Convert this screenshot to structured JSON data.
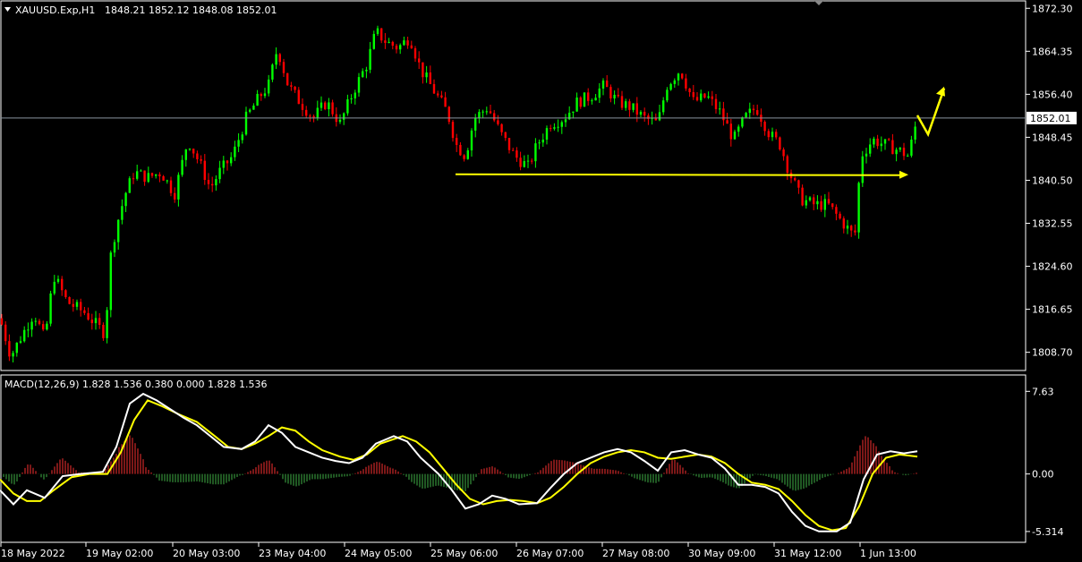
{
  "header": {
    "symbol": "XAUUSD.Exp,H1",
    "ohlc": "1848.21 1852.12 1848.08 1852.01",
    "macd_label": "MACD(12,26,9) 1.828 1.536 0.380 0.000 1.828 1.536"
  },
  "colors": {
    "background": "#000000",
    "frame": "#ffffff",
    "bull": "#00ff00",
    "bear": "#ff0000",
    "current_price_line": "#8a94a0",
    "annotation": "#ffff00",
    "macd_line": "#ffffff",
    "signal_line": "#ffff00",
    "histogram_positive": "#b22222",
    "histogram_negative": "#2e7d32"
  },
  "chart_data": [
    {
      "type": "candlestick",
      "name": "price",
      "ylim": [
        1805.5,
        1873.5
      ],
      "y_ticks": [
        "1872.30",
        "1864.35",
        "1856.40",
        "1848.45",
        "1840.50",
        "1832.55",
        "1824.60",
        "1816.65",
        "1808.70"
      ],
      "current_price": "1852.01",
      "x_labels": [
        "18 May 2022",
        "19 May 02:00",
        "20 May 03:00",
        "23 May 04:00",
        "24 May 05:00",
        "25 May 06:00",
        "26 May 07:00",
        "27 May 08:00",
        "30 May 09:00",
        "31 May 12:00",
        "1 Jun 13:00"
      ],
      "close_path": [
        [
          0,
          1815
        ],
        [
          12,
          1808
        ],
        [
          25,
          1812
        ],
        [
          38,
          1816
        ],
        [
          50,
          1811
        ],
        [
          60,
          1823
        ],
        [
          75,
          1818
        ],
        [
          95,
          1816
        ],
        [
          118,
          1812
        ],
        [
          122,
          1825
        ],
        [
          130,
          1832
        ],
        [
          140,
          1838
        ],
        [
          150,
          1842
        ],
        [
          165,
          1841
        ],
        [
          180,
          1842
        ],
        [
          195,
          1838
        ],
        [
          210,
          1848
        ],
        [
          225,
          1843
        ],
        [
          235,
          1839
        ],
        [
          245,
          1842
        ],
        [
          260,
          1845
        ],
        [
          275,
          1852
        ],
        [
          290,
          1856
        ],
        [
          300,
          1858
        ],
        [
          310,
          1865
        ],
        [
          322,
          1858
        ],
        [
          335,
          1855
        ],
        [
          350,
          1852
        ],
        [
          365,
          1855
        ],
        [
          380,
          1851
        ],
        [
          395,
          1857
        ],
        [
          410,
          1862
        ],
        [
          420,
          1868
        ],
        [
          432,
          1866
        ],
        [
          445,
          1865
        ],
        [
          458,
          1867
        ],
        [
          470,
          1861
        ],
        [
          485,
          1857
        ],
        [
          500,
          1853
        ],
        [
          510,
          1847
        ],
        [
          520,
          1845
        ],
        [
          530,
          1852
        ],
        [
          545,
          1854
        ],
        [
          560,
          1849
        ],
        [
          575,
          1845
        ],
        [
          590,
          1843
        ],
        [
          600,
          1847
        ],
        [
          615,
          1851
        ],
        [
          630,
          1852
        ],
        [
          645,
          1855
        ],
        [
          660,
          1856
        ],
        [
          675,
          1858
        ],
        [
          690,
          1855
        ],
        [
          705,
          1854
        ],
        [
          720,
          1852
        ],
        [
          735,
          1851
        ],
        [
          745,
          1858
        ],
        [
          760,
          1861
        ],
        [
          775,
          1855
        ],
        [
          790,
          1856
        ],
        [
          805,
          1853
        ],
        [
          820,
          1848
        ],
        [
          832,
          1852
        ],
        [
          845,
          1854
        ],
        [
          860,
          1849
        ],
        [
          872,
          1847
        ],
        [
          882,
          1842
        ],
        [
          895,
          1837
        ],
        [
          910,
          1836
        ],
        [
          925,
          1836
        ],
        [
          940,
          1833
        ],
        [
          955,
          1830
        ],
        [
          962,
          1845
        ],
        [
          975,
          1848
        ],
        [
          990,
          1847
        ],
        [
          1005,
          1846
        ],
        [
          1015,
          1845
        ],
        [
          1025,
          1852
        ]
      ],
      "support_line": {
        "y": 1841.6,
        "x_from": 509,
        "x_to": 1015
      },
      "projected_path": [
        [
          1025,
          1852.5
        ],
        [
          1037,
          1849
        ],
        [
          1055,
          1857.5
        ]
      ]
    },
    {
      "type": "macd",
      "name": "MACD(12,26,9)",
      "ylim": [
        -5.9,
        8.4
      ],
      "y_ticks": [
        "7.63",
        "0.00",
        "-5.314"
      ],
      "macd_path": [
        [
          0,
          -1.5
        ],
        [
          15,
          -2.8
        ],
        [
          30,
          -1.5
        ],
        [
          50,
          -2.2
        ],
        [
          70,
          -0.2
        ],
        [
          90,
          0.0
        ],
        [
          115,
          0.2
        ],
        [
          130,
          2.5
        ],
        [
          145,
          6.5
        ],
        [
          160,
          7.4
        ],
        [
          175,
          6.8
        ],
        [
          190,
          6.0
        ],
        [
          205,
          5.2
        ],
        [
          220,
          4.5
        ],
        [
          235,
          3.5
        ],
        [
          250,
          2.5
        ],
        [
          270,
          2.3
        ],
        [
          285,
          3.0
        ],
        [
          300,
          4.5
        ],
        [
          315,
          3.8
        ],
        [
          330,
          2.5
        ],
        [
          345,
          2.0
        ],
        [
          360,
          1.5
        ],
        [
          375,
          1.2
        ],
        [
          390,
          1.0
        ],
        [
          405,
          1.5
        ],
        [
          420,
          2.8
        ],
        [
          440,
          3.5
        ],
        [
          455,
          3.0
        ],
        [
          470,
          1.5
        ],
        [
          490,
          0.0
        ],
        [
          505,
          -1.5
        ],
        [
          520,
          -3.2
        ],
        [
          535,
          -2.8
        ],
        [
          550,
          -2.0
        ],
        [
          565,
          -2.3
        ],
        [
          580,
          -2.8
        ],
        [
          600,
          -2.7
        ],
        [
          615,
          -1.3
        ],
        [
          630,
          0.0
        ],
        [
          645,
          1.0
        ],
        [
          660,
          1.5
        ],
        [
          675,
          2.0
        ],
        [
          690,
          2.3
        ],
        [
          705,
          2.0
        ],
        [
          720,
          1.2
        ],
        [
          735,
          0.3
        ],
        [
          750,
          2.0
        ],
        [
          765,
          2.2
        ],
        [
          780,
          1.8
        ],
        [
          795,
          1.5
        ],
        [
          810,
          0.5
        ],
        [
          825,
          -1.0
        ],
        [
          840,
          -1.0
        ],
        [
          855,
          -1.2
        ],
        [
          870,
          -1.8
        ],
        [
          885,
          -3.5
        ],
        [
          900,
          -4.8
        ],
        [
          915,
          -5.3
        ],
        [
          935,
          -5.3
        ],
        [
          950,
          -4.5
        ],
        [
          965,
          -0.5
        ],
        [
          980,
          1.8
        ],
        [
          995,
          2.1
        ],
        [
          1010,
          1.9
        ],
        [
          1025,
          2.1
        ]
      ],
      "signal_path": [
        [
          0,
          -0.5
        ],
        [
          15,
          -1.8
        ],
        [
          30,
          -2.5
        ],
        [
          45,
          -2.5
        ],
        [
          60,
          -1.5
        ],
        [
          80,
          -0.3
        ],
        [
          100,
          0.0
        ],
        [
          120,
          0.0
        ],
        [
          135,
          2.0
        ],
        [
          150,
          5.0
        ],
        [
          165,
          6.8
        ],
        [
          180,
          6.3
        ],
        [
          200,
          5.5
        ],
        [
          220,
          4.8
        ],
        [
          240,
          3.5
        ],
        [
          255,
          2.5
        ],
        [
          270,
          2.3
        ],
        [
          285,
          2.8
        ],
        [
          300,
          3.5
        ],
        [
          315,
          4.3
        ],
        [
          330,
          4.0
        ],
        [
          345,
          3.0
        ],
        [
          360,
          2.2
        ],
        [
          380,
          1.6
        ],
        [
          395,
          1.3
        ],
        [
          410,
          1.8
        ],
        [
          425,
          2.8
        ],
        [
          450,
          3.5
        ],
        [
          465,
          3.0
        ],
        [
          480,
          2.0
        ],
        [
          495,
          0.5
        ],
        [
          510,
          -1.0
        ],
        [
          525,
          -2.3
        ],
        [
          540,
          -2.8
        ],
        [
          555,
          -2.5
        ],
        [
          570,
          -2.4
        ],
        [
          585,
          -2.5
        ],
        [
          600,
          -2.7
        ],
        [
          615,
          -2.2
        ],
        [
          630,
          -1.2
        ],
        [
          645,
          0.0
        ],
        [
          660,
          1.0
        ],
        [
          675,
          1.6
        ],
        [
          690,
          2.0
        ],
        [
          705,
          2.2
        ],
        [
          720,
          2.0
        ],
        [
          735,
          1.5
        ],
        [
          750,
          1.4
        ],
        [
          765,
          1.6
        ],
        [
          780,
          1.8
        ],
        [
          795,
          1.6
        ],
        [
          810,
          1.0
        ],
        [
          825,
          0.0
        ],
        [
          840,
          -0.8
        ],
        [
          855,
          -1.0
        ],
        [
          870,
          -1.4
        ],
        [
          885,
          -2.5
        ],
        [
          900,
          -3.8
        ],
        [
          915,
          -4.8
        ],
        [
          930,
          -5.2
        ],
        [
          945,
          -5.0
        ],
        [
          960,
          -3.0
        ],
        [
          975,
          0.0
        ],
        [
          990,
          1.5
        ],
        [
          1005,
          1.8
        ],
        [
          1025,
          1.6
        ]
      ]
    }
  ]
}
